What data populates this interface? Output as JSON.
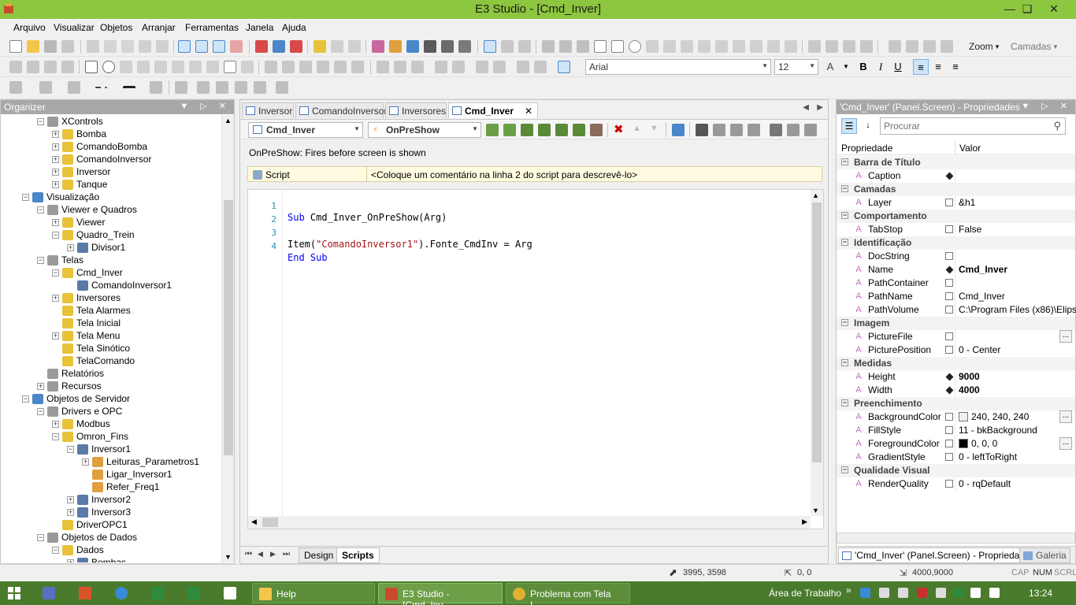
{
  "window": {
    "title": "E3 Studio - [Cmd_Inver]"
  },
  "menu": [
    "Arquivo",
    "Visualizar",
    "Objetos",
    "Arranjar",
    "Ferramentas",
    "Janela",
    "Ajuda"
  ],
  "toolbar": {
    "zoom_label": "Zoom",
    "camadas_label": "Camadas",
    "font_name": "Arial",
    "font_size": "12"
  },
  "organizer": {
    "title": "Organizer",
    "nodes": [
      {
        "label": "XControls",
        "level": 2,
        "exp": "−"
      },
      {
        "label": "Bomba",
        "level": 3,
        "exp": "+"
      },
      {
        "label": "ComandoBomba",
        "level": 3,
        "exp": "+"
      },
      {
        "label": "ComandoInversor",
        "level": 3,
        "exp": "+"
      },
      {
        "label": "Inversor",
        "level": 3,
        "exp": "+"
      },
      {
        "label": "Tanque",
        "level": 3,
        "exp": "+"
      },
      {
        "label": "Visualização",
        "level": 1,
        "exp": "−"
      },
      {
        "label": "Viewer e Quadros",
        "level": 2,
        "exp": "−"
      },
      {
        "label": "Viewer",
        "level": 3,
        "exp": "+"
      },
      {
        "label": "Quadro_Trein",
        "level": 3,
        "exp": "−"
      },
      {
        "label": "Divisor1",
        "level": 4,
        "exp": "+"
      },
      {
        "label": "Telas",
        "level": 2,
        "exp": "−"
      },
      {
        "label": "Cmd_Inver",
        "level": 3,
        "exp": "−"
      },
      {
        "label": "ComandoInversor1",
        "level": 4,
        "exp": ""
      },
      {
        "label": "Inversores",
        "level": 3,
        "exp": "+"
      },
      {
        "label": "Tela Alarmes",
        "level": 3,
        "exp": ""
      },
      {
        "label": "Tela Inicial",
        "level": 3,
        "exp": ""
      },
      {
        "label": "Tela Menu",
        "level": 3,
        "exp": "+"
      },
      {
        "label": "Tela Sinótico",
        "level": 3,
        "exp": ""
      },
      {
        "label": "TelaComando",
        "level": 3,
        "exp": ""
      },
      {
        "label": "Relatórios",
        "level": 2,
        "exp": ""
      },
      {
        "label": "Recursos",
        "level": 2,
        "exp": "+"
      },
      {
        "label": "Objetos de Servidor",
        "level": 1,
        "exp": "−"
      },
      {
        "label": "Drivers e OPC",
        "level": 2,
        "exp": "−"
      },
      {
        "label": "Modbus",
        "level": 3,
        "exp": "+"
      },
      {
        "label": "Omron_Fins",
        "level": 3,
        "exp": "−"
      },
      {
        "label": "Inversor1",
        "level": 4,
        "exp": "−"
      },
      {
        "label": "Leituras_Parametros1",
        "level": 5,
        "exp": "+"
      },
      {
        "label": "Ligar_Inversor1",
        "level": 5,
        "exp": ""
      },
      {
        "label": "Refer_Freq1",
        "level": 5,
        "exp": ""
      },
      {
        "label": "Inversor2",
        "level": 4,
        "exp": "+"
      },
      {
        "label": "Inversor3",
        "level": 4,
        "exp": "+"
      },
      {
        "label": "DriverOPC1",
        "level": 3,
        "exp": ""
      },
      {
        "label": "Objetos de Dados",
        "level": 2,
        "exp": "−"
      },
      {
        "label": "Dados",
        "level": 3,
        "exp": "−"
      },
      {
        "label": "Bombas",
        "level": 4,
        "exp": "+"
      }
    ]
  },
  "editor": {
    "tabs": [
      "Inversor",
      "ComandoInversor",
      "Inversores",
      "Cmd_Inver"
    ],
    "object_combo": "Cmd_Inver",
    "event_combo": "OnPreShow",
    "event_desc": "OnPreShow: Fires before screen is shown",
    "script_label": "Script",
    "script_comment": "<Coloque um comentário na linha 2 do script para descrevê-lo>",
    "line_numbers": [
      "1",
      "2",
      "3",
      "4"
    ],
    "code": {
      "l1_kw": "Sub",
      "l1_rest": " Cmd_Inver_OnPreShow(Arg)",
      "l3_a": "Item(",
      "l3_str": "\"ComandoInversor1\"",
      "l3_b": ").Fonte_CmdInv = Arg",
      "l4_kw": "End Sub"
    },
    "bottom_tabs": [
      "Design",
      "Scripts"
    ]
  },
  "properties": {
    "title": "'Cmd_Inver' (Panel.Screen) - Propriedades",
    "search_placeholder": "Procurar",
    "col_prop": "Propriedade",
    "col_val": "Valor",
    "rows": [
      {
        "cat": "Barra de Título"
      },
      {
        "name": "Caption",
        "val": "",
        "flag": "set"
      },
      {
        "cat": "Camadas"
      },
      {
        "name": "Layer",
        "val": "&h1",
        "flag": "box"
      },
      {
        "cat": "Comportamento"
      },
      {
        "name": "TabStop",
        "val": "False",
        "flag": "box"
      },
      {
        "cat": "Identificação"
      },
      {
        "name": "DocString",
        "val": "",
        "flag": "box"
      },
      {
        "name": "Name",
        "val": "Cmd_Inver",
        "flag": "set",
        "bold": true
      },
      {
        "name": "PathContainer",
        "val": "",
        "flag": "box"
      },
      {
        "name": "PathName",
        "val": "Cmd_Inver",
        "flag": "box"
      },
      {
        "name": "PathVolume",
        "val": "C:\\Program Files (x86)\\Elips...",
        "flag": "box"
      },
      {
        "cat": "Imagem"
      },
      {
        "name": "PictureFile",
        "val": "",
        "flag": "box",
        "ellipsis": true
      },
      {
        "name": "PicturePosition",
        "val": "0 - Center",
        "flag": "box"
      },
      {
        "cat": "Medidas"
      },
      {
        "name": "Height",
        "val": "9000",
        "flag": "set",
        "bold": true
      },
      {
        "name": "Width",
        "val": "4000",
        "flag": "set",
        "bold": true
      },
      {
        "cat": "Preenchimento"
      },
      {
        "name": "BackgroundColor",
        "val": "240, 240, 240",
        "flag": "box",
        "ellipsis": true,
        "swatch": "#f0f0f0"
      },
      {
        "name": "FillStyle",
        "val": "11 - bkBackground",
        "flag": "box"
      },
      {
        "name": "ForegroundColor",
        "val": "0, 0, 0",
        "flag": "box",
        "ellipsis": true,
        "swatch": "#000000"
      },
      {
        "name": "GradientStyle",
        "val": "0 - leftToRight",
        "flag": "box"
      },
      {
        "cat": "Qualidade Visual"
      },
      {
        "name": "RenderQuality",
        "val": "0 - rqDefault",
        "flag": "box"
      }
    ],
    "bottom_tab_props": "'Cmd_Inver' (Panel.Screen) - Propriedades",
    "bottom_tab_gallery": "Galeria"
  },
  "status": {
    "cursor": "3995, 3598",
    "offset": "0, 0",
    "size": "4000,9000",
    "cap": "CAP",
    "num": "NUM",
    "scrl": "SCRL"
  },
  "taskbar": {
    "buttons": [
      "Help",
      "E3 Studio - [Cmd_Inv...",
      "Problema com Tela I..."
    ],
    "desktop_label": "Área de Trabalho",
    "clock": "13:24"
  }
}
